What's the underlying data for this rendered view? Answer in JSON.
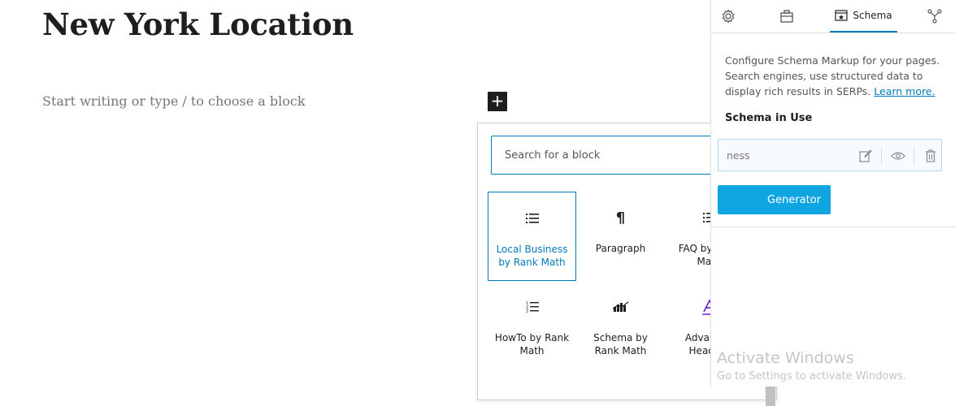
{
  "editor": {
    "title": "New York Location",
    "placeholder": "Start writing or type / to choose a block",
    "add_block_label": "+"
  },
  "inserter": {
    "search_placeholder": "Search for a block",
    "blocks": [
      {
        "label": "Local Business by Rank Math",
        "icon": "list-icon",
        "selected": true
      },
      {
        "label": "Paragraph",
        "icon": "pilcrow-icon",
        "selected": false
      },
      {
        "label": "FAQ by Rank Math",
        "icon": "list-icon",
        "selected": false
      },
      {
        "label": "HowTo by Rank Math",
        "icon": "ordered-list-icon",
        "selected": false
      },
      {
        "label": "Schema by Rank Math",
        "icon": "schema-chart-icon",
        "selected": false
      },
      {
        "label": "Advanced Heading",
        "icon": "heading-a-icon",
        "selected": false
      }
    ]
  },
  "sidebar": {
    "tabs": [
      {
        "label": "",
        "icon": "gear-icon"
      },
      {
        "label": "",
        "icon": "briefcase-icon"
      },
      {
        "label": "Schema",
        "icon": "schema-icon"
      },
      {
        "label": "",
        "icon": "social-share-icon"
      }
    ],
    "active_tab": "Schema",
    "description": "Configure Schema Markup for your pages. Search engines, use structured data to display rich results in SERPs.",
    "learn_more": "Learn more.",
    "schema_heading": "Schema in Use",
    "schema_item": "ness",
    "generator_button": "Generator"
  },
  "watermark": {
    "title": "Activate Windows",
    "subtitle": "Go to Settings to activate Windows."
  },
  "colors": {
    "accent": "#007cba",
    "button": "#0ea5e0"
  }
}
